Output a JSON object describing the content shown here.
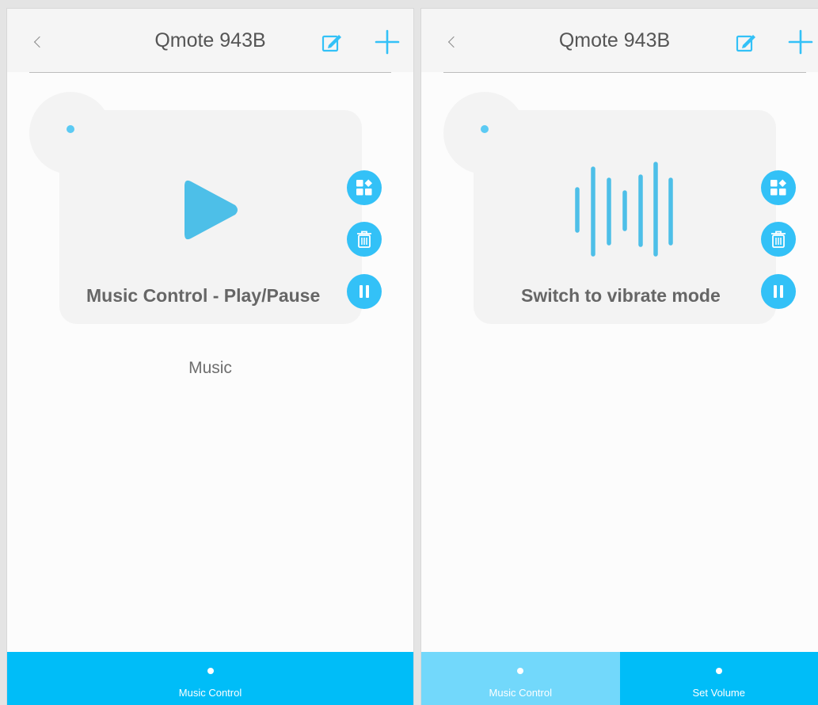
{
  "screens": [
    {
      "header": {
        "title": "Qmote 943B"
      },
      "card": {
        "icon": "play-icon",
        "label": "Music Control - Play/Pause"
      },
      "section_label": "Music",
      "tabs": [
        {
          "label": "Music Control",
          "active": true
        }
      ]
    },
    {
      "header": {
        "title": "Qmote 943B"
      },
      "card": {
        "icon": "vibrate-bars-icon",
        "label": "Switch to vibrate mode"
      },
      "tabs": [
        {
          "label": "Music Control",
          "active": false
        },
        {
          "label": "Set Volume",
          "active": true
        }
      ]
    }
  ],
  "icons": {
    "back": "chevron-left-icon",
    "edit": "edit-icon",
    "add": "plus-icon",
    "category": "category-icon",
    "delete": "trash-icon",
    "pause": "pause-icon"
  },
  "colors": {
    "accent": "#33c1f7",
    "tab_active": "#00bdf8",
    "tab_inactive": "#72d8fb",
    "play_icon": "#4dbfe8",
    "text": "#555555"
  }
}
